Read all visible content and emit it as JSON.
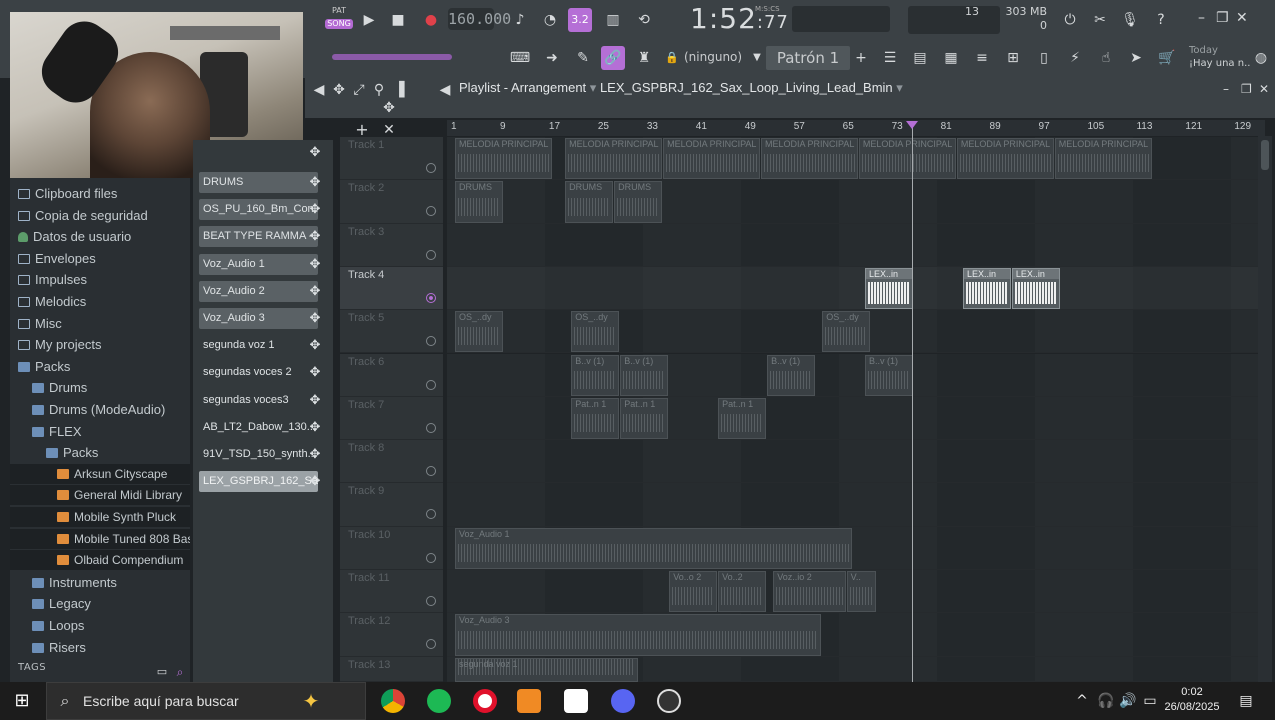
{
  "toolbar": {
    "pat_label": "PAT",
    "song_label": "SONG",
    "tempo": "160.000",
    "time_main": "1:52",
    "time_sub": ":77",
    "time_unit": "M:S:CS",
    "cpu": "13",
    "mem_value": "303 MB",
    "mem_sub": "0",
    "snap_label": "(ninguno)",
    "pattern_label": "Patrón 1",
    "news_title": "Today",
    "news_text": "¡Hay una n..",
    "accent": "#b56fd6"
  },
  "browser": {
    "items": [
      {
        "label": "Clipboard files",
        "indent": 0,
        "icon": "folder-icon"
      },
      {
        "label": "Copia de seguridad",
        "indent": 0,
        "icon": "folder-icon"
      },
      {
        "label": "Datos de usuario",
        "indent": 0,
        "icon": "user-icon"
      },
      {
        "label": "Envelopes",
        "indent": 0,
        "icon": "folder-icon"
      },
      {
        "label": "Impulses",
        "indent": 0,
        "icon": "folder-icon"
      },
      {
        "label": "Melodics",
        "indent": 0,
        "icon": "folder-icon"
      },
      {
        "label": "Misc",
        "indent": 0,
        "icon": "folder-icon"
      },
      {
        "label": "My projects",
        "indent": 0,
        "icon": "folder-icon"
      },
      {
        "label": "Packs",
        "indent": 0,
        "icon": "folder-open-icon"
      },
      {
        "label": "Drums",
        "indent": 1,
        "icon": "folder-open-icon"
      },
      {
        "label": "Drums (ModeAudio)",
        "indent": 1,
        "icon": "folder-open-icon"
      },
      {
        "label": "FLEX",
        "indent": 1,
        "icon": "folder-open-icon"
      },
      {
        "label": "Packs",
        "indent": 2,
        "icon": "folder-open-icon"
      },
      {
        "label": "Arksun Cityscape",
        "indent": 3,
        "icon": "flex-preset-icon"
      },
      {
        "label": "General Midi Library",
        "indent": 3,
        "icon": "flex-preset-icon"
      },
      {
        "label": "Mobile Synth Pluck",
        "indent": 3,
        "icon": "flex-preset-icon"
      },
      {
        "label": "Mobile Tuned 808 Bass",
        "indent": 3,
        "icon": "flex-preset-icon"
      },
      {
        "label": "Olbaid Compendium",
        "indent": 3,
        "icon": "flex-preset-icon"
      },
      {
        "label": "Instruments",
        "indent": 1,
        "icon": "folder-open-icon"
      },
      {
        "label": "Legacy",
        "indent": 1,
        "icon": "folder-open-icon"
      },
      {
        "label": "Loops",
        "indent": 1,
        "icon": "folder-open-icon"
      },
      {
        "label": "Risers",
        "indent": 1,
        "icon": "folder-open-icon"
      }
    ],
    "tags_label": "TAGS"
  },
  "picker": {
    "items": [
      {
        "label": "DRUMS",
        "style": "box"
      },
      {
        "label": "OS_PU_160_Bm_Con..",
        "style": "box"
      },
      {
        "label": "BEAT TYPE RAMMA -..",
        "style": "box"
      },
      {
        "label": "Voz_Audio 1",
        "style": "box"
      },
      {
        "label": "Voz_Audio 2",
        "style": "box"
      },
      {
        "label": "Voz_Audio 3",
        "style": "box"
      },
      {
        "label": "segunda voz  1",
        "style": "plain"
      },
      {
        "label": "segundas voces 2",
        "style": "plain"
      },
      {
        "label": "segundas voces3",
        "style": "plain"
      },
      {
        "label": "AB_LT2_Dabow_130..",
        "style": "plain"
      },
      {
        "label": "91V_TSD_150_synth..",
        "style": "plain"
      },
      {
        "label": "LEX_GSPBRJ_162_Sa..",
        "style": "sel"
      }
    ]
  },
  "playlist": {
    "title": "Playlist - Arrangement",
    "pattern_name": "LEX_GSPBRJ_162_Sax_Loop_Living_Lead_Bmin",
    "ruler": [
      "1",
      "9",
      "17",
      "25",
      "33",
      "41",
      "49",
      "57",
      "65",
      "73",
      "81",
      "89",
      "97",
      "105",
      "113",
      "121",
      "129"
    ],
    "tracks": [
      {
        "name": "Track 1",
        "active": false
      },
      {
        "name": "Track 2",
        "active": false
      },
      {
        "name": "Track 3",
        "active": false
      },
      {
        "name": "Track 4",
        "active": true
      },
      {
        "name": "Track 5",
        "active": false
      },
      {
        "name": "Track 6",
        "active": false
      },
      {
        "name": "Track 7",
        "active": false
      },
      {
        "name": "Track 8",
        "active": false
      },
      {
        "name": "Track 9",
        "active": false
      },
      {
        "name": "Track 10",
        "active": false
      },
      {
        "name": "Track 11",
        "active": false
      },
      {
        "name": "Track 12",
        "active": false
      },
      {
        "name": "Track 13",
        "active": false
      }
    ],
    "clips": [
      {
        "track": 0,
        "start": 1,
        "len": 16,
        "label": "MELODIA PRINCIPAL"
      },
      {
        "track": 0,
        "start": 19,
        "len": 16,
        "label": "MELODIA PRINCIPAL"
      },
      {
        "track": 0,
        "start": 35,
        "len": 16,
        "label": "MELODIA PRINCIPAL"
      },
      {
        "track": 0,
        "start": 51,
        "len": 16,
        "label": "MELODIA PRINCIPAL"
      },
      {
        "track": 0,
        "start": 67,
        "len": 16,
        "label": "MELODIA PRINCIPAL"
      },
      {
        "track": 0,
        "start": 83,
        "len": 16,
        "label": "MELODIA PRINCIPAL"
      },
      {
        "track": 0,
        "start": 99,
        "len": 16,
        "label": "MELODIA PRINCIPAL"
      },
      {
        "track": 1,
        "start": 1,
        "len": 8,
        "label": "DRUMS"
      },
      {
        "track": 1,
        "start": 19,
        "len": 8,
        "label": "DRUMS"
      },
      {
        "track": 1,
        "start": 27,
        "len": 8,
        "label": "DRUMS"
      },
      {
        "track": 3,
        "start": 68,
        "len": 8,
        "label": "LEX..in",
        "bright": true
      },
      {
        "track": 3,
        "start": 84,
        "len": 8,
        "label": "LEX..in",
        "bright": true
      },
      {
        "track": 3,
        "start": 92,
        "len": 8,
        "label": "LEX..in",
        "bright": true
      },
      {
        "track": 4,
        "start": 1,
        "len": 8,
        "label": "OS_..dy"
      },
      {
        "track": 4,
        "start": 20,
        "len": 8,
        "label": "OS_..dy"
      },
      {
        "track": 4,
        "start": 61,
        "len": 8,
        "label": "OS_..dy"
      },
      {
        "track": 5,
        "start": 20,
        "len": 8,
        "label": "B..v (1)"
      },
      {
        "track": 5,
        "start": 28,
        "len": 8,
        "label": "B..v (1)"
      },
      {
        "track": 5,
        "start": 52,
        "len": 8,
        "label": "B..v (1)"
      },
      {
        "track": 5,
        "start": 68,
        "len": 8,
        "label": "B..v (1)"
      },
      {
        "track": 6,
        "start": 20,
        "len": 8,
        "label": "Pat..n 1"
      },
      {
        "track": 6,
        "start": 28,
        "len": 8,
        "label": "Pat..n 1"
      },
      {
        "track": 6,
        "start": 44,
        "len": 8,
        "label": "Pat..n 1"
      },
      {
        "track": 9,
        "start": 1,
        "len": 65,
        "label": "Voz_Audio 1"
      },
      {
        "track": 10,
        "start": 36,
        "len": 8,
        "label": "Vo..o 2"
      },
      {
        "track": 10,
        "start": 44,
        "len": 8,
        "label": "Vo..2"
      },
      {
        "track": 10,
        "start": 53,
        "len": 12,
        "label": "Voz..io 2"
      },
      {
        "track": 10,
        "start": 65,
        "len": 5,
        "label": "V.."
      },
      {
        "track": 11,
        "start": 1,
        "len": 60,
        "label": "Voz_Audio 3"
      },
      {
        "track": 12,
        "start": 1,
        "len": 30,
        "label": "segunda voz  1"
      }
    ]
  },
  "taskbar": {
    "search_placeholder": "Escribe aquí para buscar",
    "time": "0:02",
    "date": "26/08/2025",
    "apps": [
      "chrome-icon",
      "spotify-icon",
      "opera-icon",
      "fl-studio-icon",
      "capcut-icon",
      "discord-icon",
      "obs-icon"
    ]
  }
}
